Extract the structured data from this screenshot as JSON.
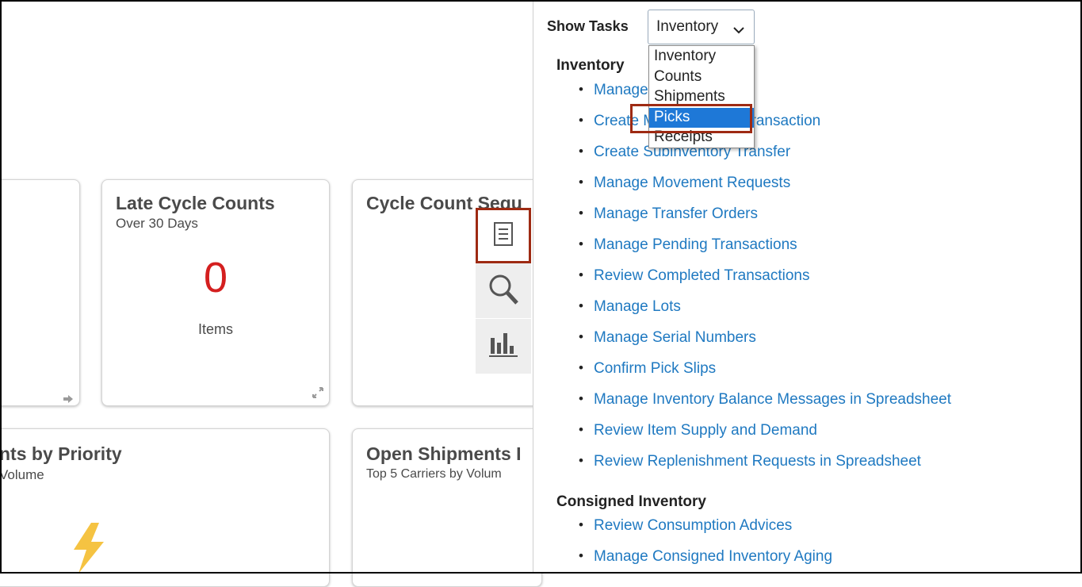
{
  "cards": {
    "late_cycle": {
      "title": "Late Cycle Counts",
      "subtitle": "Over 30 Days",
      "value": "0",
      "units": "Items"
    },
    "cycle_seq": {
      "title": "Cycle Count Sequ"
    },
    "priority": {
      "title": "nts by Priority",
      "subtitle": "Volume"
    },
    "open_ship": {
      "title": "Open Shipments I",
      "subtitle": "Top 5 Carriers by Volum"
    }
  },
  "tools": {
    "icons": [
      "list-icon",
      "search-icon",
      "bar-chart-icon"
    ]
  },
  "panel": {
    "show_tasks_label": "Show Tasks",
    "selected_value": "Inventory",
    "dropdown_options": [
      "Inventory",
      "Counts",
      "Shipments",
      "Picks",
      "Receipts"
    ],
    "highlighted_option": "Picks",
    "sections": [
      {
        "heading": "Inventory",
        "tasks": [
          "Manage Item Quantities",
          "Create Miscellaneous Transaction",
          "Create Subinventory Transfer",
          "Manage Movement Requests",
          "Manage Transfer Orders",
          "Manage Pending Transactions",
          "Review Completed Transactions",
          "Manage Lots",
          "Manage Serial Numbers",
          "Confirm Pick Slips",
          "Manage Inventory Balance Messages in Spreadsheet",
          "Review Item Supply and Demand",
          "Review Replenishment Requests in Spreadsheet"
        ]
      },
      {
        "heading": "Consigned Inventory",
        "tasks": [
          "Review Consumption Advices",
          "Manage Consigned Inventory Aging"
        ]
      }
    ]
  },
  "colors": {
    "link": "#1f79c1",
    "alert_number": "#d41f1f",
    "highlight_border": "#9e2a13",
    "option_selected": "#1e78d7"
  }
}
